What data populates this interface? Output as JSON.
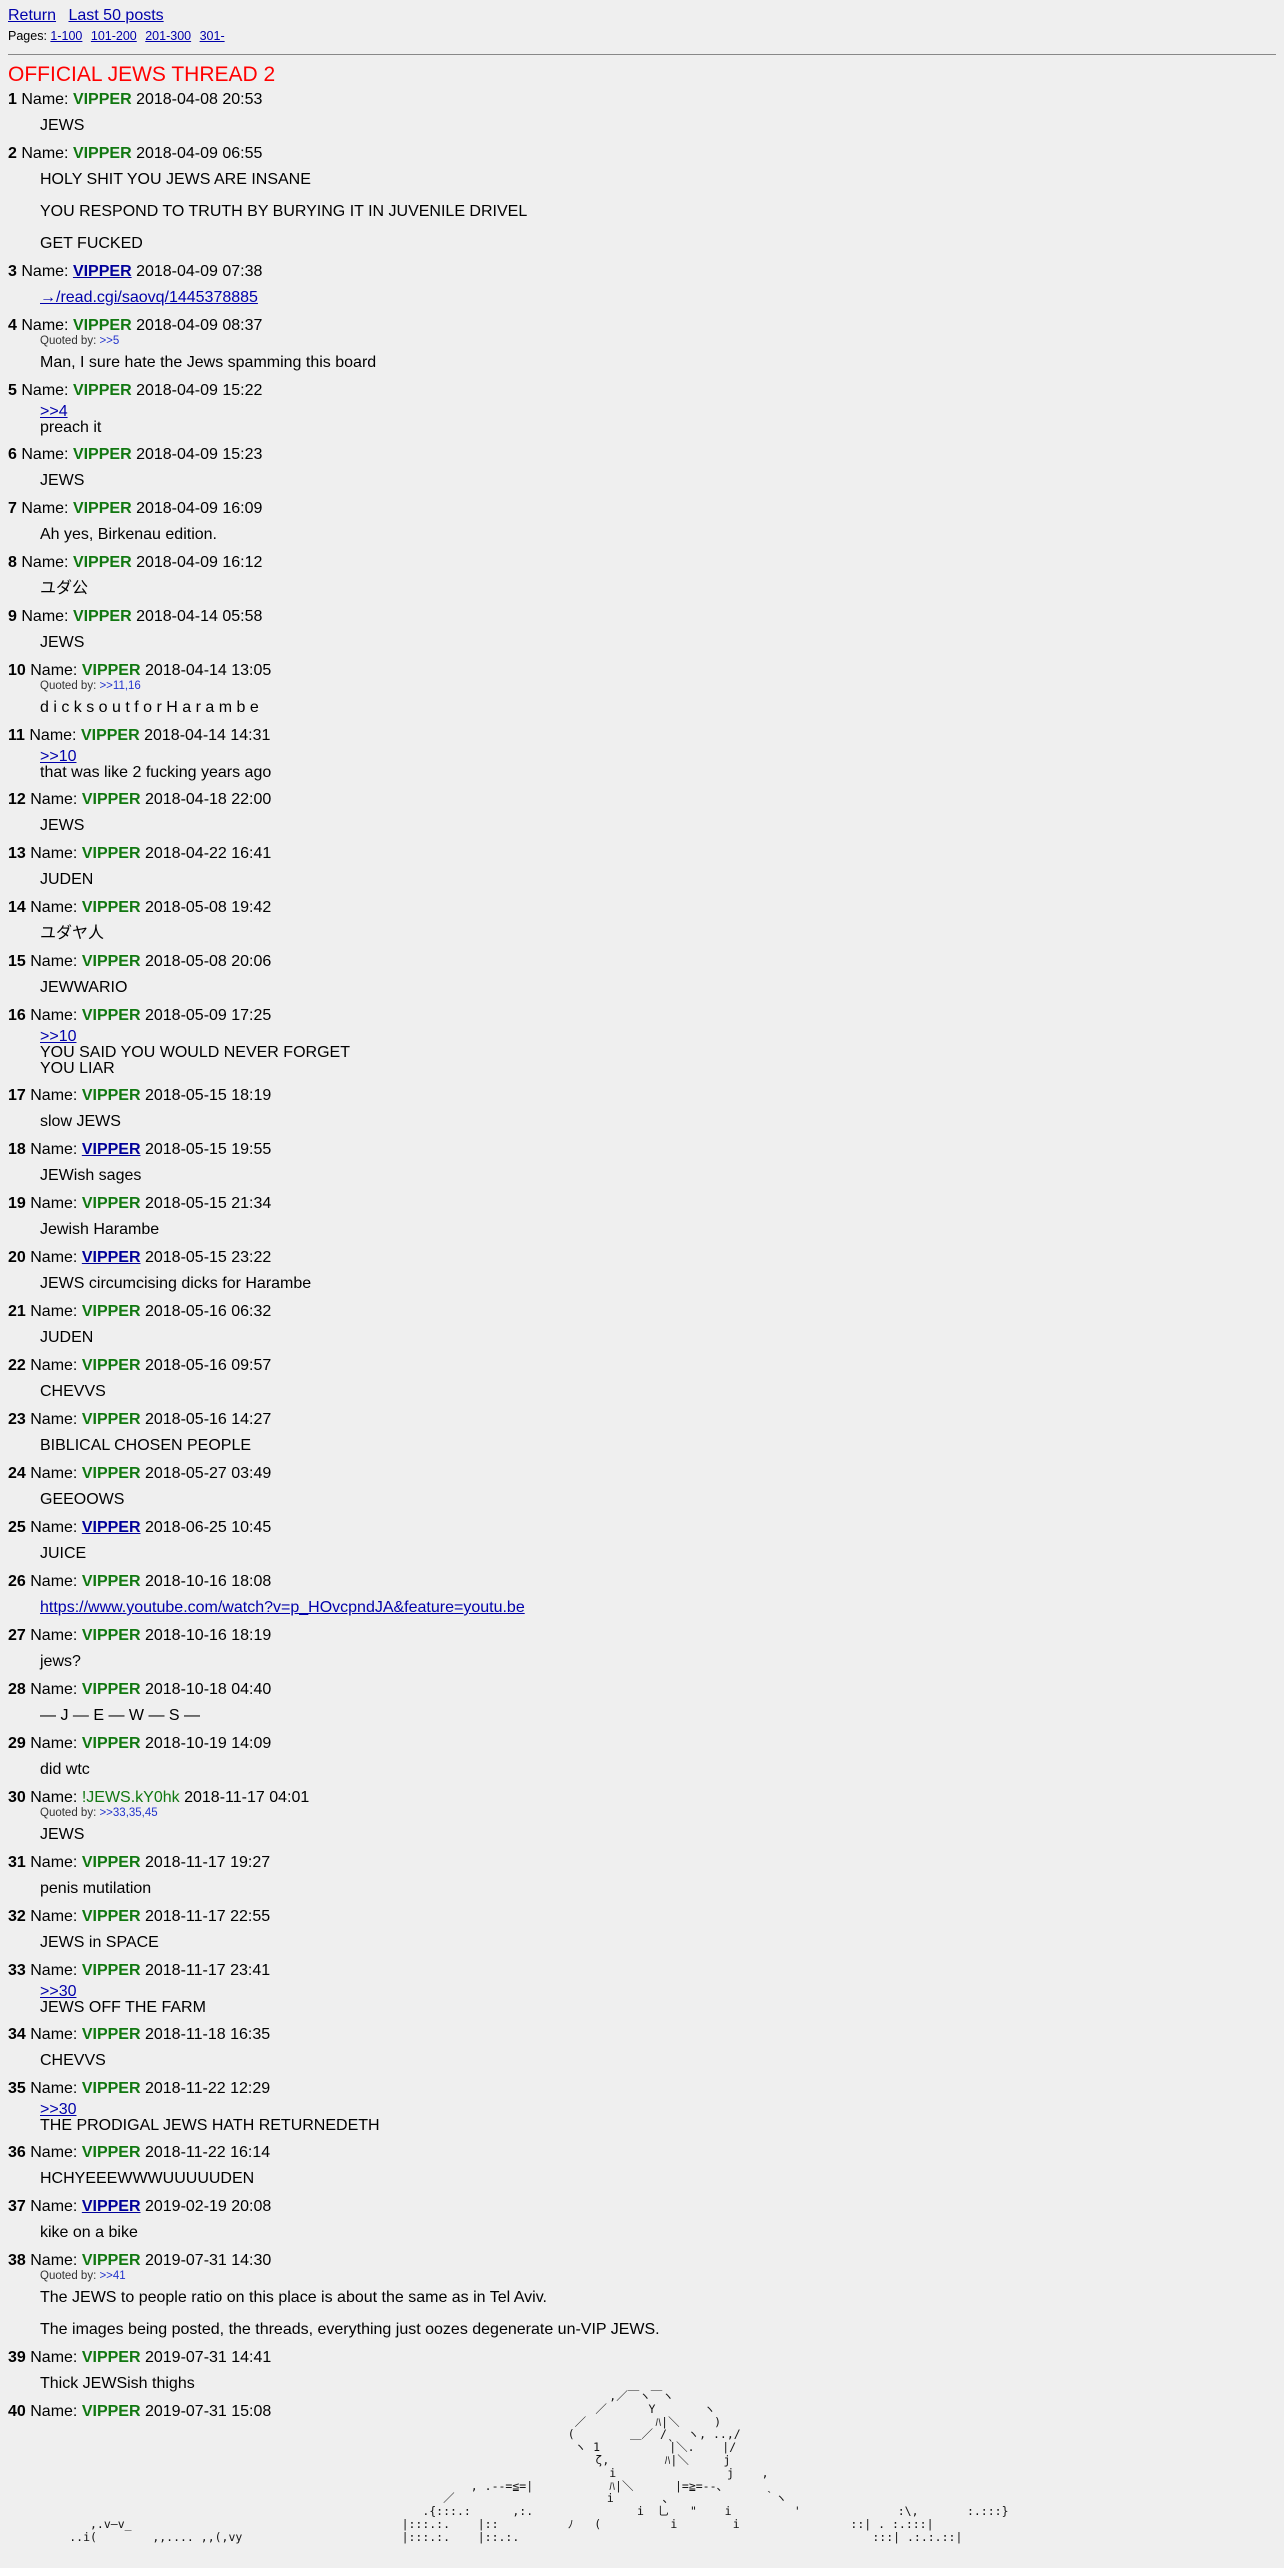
{
  "nav": {
    "return_label": "Return",
    "last50_label": "Last 50 posts",
    "pages_label": "Pages:",
    "pages": [
      "1-100",
      "101-200",
      "201-300",
      "301-"
    ]
  },
  "thread_title": "OFFICIAL JEWS THREAD 2",
  "name_label": "Name:",
  "quoted_by_label": "Quoted by:",
  "posts": [
    {
      "num": "1",
      "name": "VIPPER",
      "date": "2018-04-08 20:53",
      "body": [
        "JEWS"
      ]
    },
    {
      "num": "2",
      "name": "VIPPER",
      "date": "2018-04-09 06:55",
      "body": [
        "HOLY SHIT YOU JEWS ARE INSANE",
        "YOU RESPOND TO TRUTH BY BURYING IT IN JUVENILE DRIVEL",
        "GET FUCKED"
      ]
    },
    {
      "num": "3",
      "name": "VIPPER",
      "mail": true,
      "date": "2018-04-09 07:38",
      "link": "→/read.cgi/saovq/1445378885"
    },
    {
      "num": "4",
      "name": "VIPPER",
      "date": "2018-04-09 08:37",
      "quoted_by": ">>5",
      "body": [
        "Man, I sure hate the Jews spamming this board"
      ]
    },
    {
      "num": "5",
      "name": "VIPPER",
      "date": "2018-04-09 15:22",
      "ref": ">>4",
      "lines": [
        "preach it"
      ]
    },
    {
      "num": "6",
      "name": "VIPPER",
      "date": "2018-04-09 15:23",
      "body": [
        "JEWS"
      ]
    },
    {
      "num": "7",
      "name": "VIPPER",
      "date": "2018-04-09 16:09",
      "body": [
        "Ah yes, Birkenau edition."
      ]
    },
    {
      "num": "8",
      "name": "VIPPER",
      "date": "2018-04-09 16:12",
      "body": [
        "ユダ公"
      ]
    },
    {
      "num": "9",
      "name": "VIPPER",
      "date": "2018-04-14 05:58",
      "body": [
        "JEWS"
      ]
    },
    {
      "num": "10",
      "name": "VIPPER",
      "date": "2018-04-14 13:05",
      "quoted_by": ">>11,16",
      "body": [
        "d i c k s o u t f o r H a r a m b e"
      ]
    },
    {
      "num": "11",
      "name": "VIPPER",
      "date": "2018-04-14 14:31",
      "ref": ">>10",
      "lines": [
        "that was like 2 fucking years ago"
      ]
    },
    {
      "num": "12",
      "name": "VIPPER",
      "date": "2018-04-18 22:00",
      "body": [
        "JEWS"
      ]
    },
    {
      "num": "13",
      "name": "VIPPER",
      "date": "2018-04-22 16:41",
      "body": [
        "JUDEN"
      ]
    },
    {
      "num": "14",
      "name": "VIPPER",
      "date": "2018-05-08 19:42",
      "body": [
        "ユダヤ人"
      ]
    },
    {
      "num": "15",
      "name": "VIPPER",
      "date": "2018-05-08 20:06",
      "body": [
        "JEWWARIO"
      ]
    },
    {
      "num": "16",
      "name": "VIPPER",
      "date": "2018-05-09 17:25",
      "ref": ">>10",
      "lines": [
        "YOU SAID YOU WOULD NEVER FORGET",
        "YOU LIAR"
      ]
    },
    {
      "num": "17",
      "name": "VIPPER",
      "date": "2018-05-15 18:19",
      "body": [
        "slow JEWS"
      ]
    },
    {
      "num": "18",
      "name": "VIPPER",
      "mail": true,
      "date": "2018-05-15 19:55",
      "body": [
        "JEWish sages"
      ]
    },
    {
      "num": "19",
      "name": "VIPPER",
      "date": "2018-05-15 21:34",
      "body": [
        "Jewish Harambe"
      ]
    },
    {
      "num": "20",
      "name": "VIPPER",
      "mail": true,
      "date": "2018-05-15 23:22",
      "body": [
        "JEWS circumcising dicks for Harambe"
      ]
    },
    {
      "num": "21",
      "name": "VIPPER",
      "date": "2018-05-16 06:32",
      "body": [
        "JUDEN"
      ]
    },
    {
      "num": "22",
      "name": "VIPPER",
      "date": "2018-05-16 09:57",
      "body": [
        "CHEVVS"
      ]
    },
    {
      "num": "23",
      "name": "VIPPER",
      "date": "2018-05-16 14:27",
      "body": [
        "BIBLICAL CHOSEN PEOPLE"
      ]
    },
    {
      "num": "24",
      "name": "VIPPER",
      "date": "2018-05-27 03:49",
      "body": [
        "GEEOOWS"
      ]
    },
    {
      "num": "25",
      "name": "VIPPER",
      "mail": true,
      "date": "2018-06-25 10:45",
      "body": [
        "JUICE"
      ]
    },
    {
      "num": "26",
      "name": "VIPPER",
      "date": "2018-10-16 18:08",
      "link": "https://www.youtube.com/watch?v=p_HOvcpndJA&feature=youtu.be"
    },
    {
      "num": "27",
      "name": "VIPPER",
      "date": "2018-10-16 18:19",
      "body": [
        "jews?"
      ]
    },
    {
      "num": "28",
      "name": "VIPPER",
      "date": "2018-10-18 04:40",
      "body": [
        "— J — E — W — S —"
      ]
    },
    {
      "num": "29",
      "name": "VIPPER",
      "date": "2018-10-19 14:09",
      "body": [
        "did wtc"
      ]
    },
    {
      "num": "30",
      "name": "!JEWS.kY0hk",
      "trip": true,
      "date": "2018-11-17 04:01",
      "quoted_by": ">>33,35,45",
      "body": [
        "JEWS"
      ]
    },
    {
      "num": "31",
      "name": "VIPPER",
      "date": "2018-11-17 19:27",
      "body": [
        "penis mutilation"
      ]
    },
    {
      "num": "32",
      "name": "VIPPER",
      "date": "2018-11-17 22:55",
      "body": [
        "JEWS in SPACE"
      ]
    },
    {
      "num": "33",
      "name": "VIPPER",
      "date": "2018-11-17 23:41",
      "ref": ">>30",
      "lines": [
        "JEWS OFF THE FARM"
      ]
    },
    {
      "num": "34",
      "name": "VIPPER",
      "date": "2018-11-18 16:35",
      "body": [
        "CHEVVS"
      ]
    },
    {
      "num": "35",
      "name": "VIPPER",
      "date": "2018-11-22 12:29",
      "ref": ">>30",
      "lines": [
        "THE PRODIGAL JEWS HATH RETURNEDETH"
      ]
    },
    {
      "num": "36",
      "name": "VIPPER",
      "date": "2018-11-22 16:14",
      "body": [
        "HCHYEEEWWWUUUUUDEN"
      ]
    },
    {
      "num": "37",
      "name": "VIPPER",
      "mail": true,
      "date": "2019-02-19 20:08",
      "body": [
        "kike on a bike"
      ]
    },
    {
      "num": "38",
      "name": "VIPPER",
      "date": "2019-07-31 14:30",
      "quoted_by": ">>41",
      "body": [
        "The JEWS to people ratio on this place is about the same as in Tel Aviv.",
        "The images being posted, the threads, everything just oozes degenerate un-VIP JEWS."
      ]
    },
    {
      "num": "39",
      "name": "VIPPER",
      "date": "2019-07-31 14:41",
      "body": [
        "Thick JEWSish thighs"
      ]
    },
    {
      "num": "40",
      "name": "VIPPER",
      "date": "2019-07-31 15:08",
      "body": []
    }
  ],
  "ascii_art": "                                                                                        ,／￣ヽ￣ヽ\n                                                                                      ／      Y       ヽ\n                                                                                   ／          ﾊ|＼     )\n                                                                                  (        ＿／ /ˎ  ヽ, ..,/\n                                                                                   ヽ 1          |＼.    |/\n                                                                                      ζ,        ﾊ|＼     j\n                                                                                        i                j    ,\n                                                                    , .--=≦=|           ﾊ|＼      |=≧=--、\n                                                                ／                      i       、             ｀ヽ\n                                                             .{:::.:      ,:.               i  乚   \"    i         '              :\\,       :.:::}\n             ,.v―v_                                       |:::.:.    |::          ﾉ   (          i        i                ::| . :.:::|\n          ..i(        ,,.... ,,(,vy                       |:::.:.    |::.:.                                                   :::| .:.:.::|"
}
